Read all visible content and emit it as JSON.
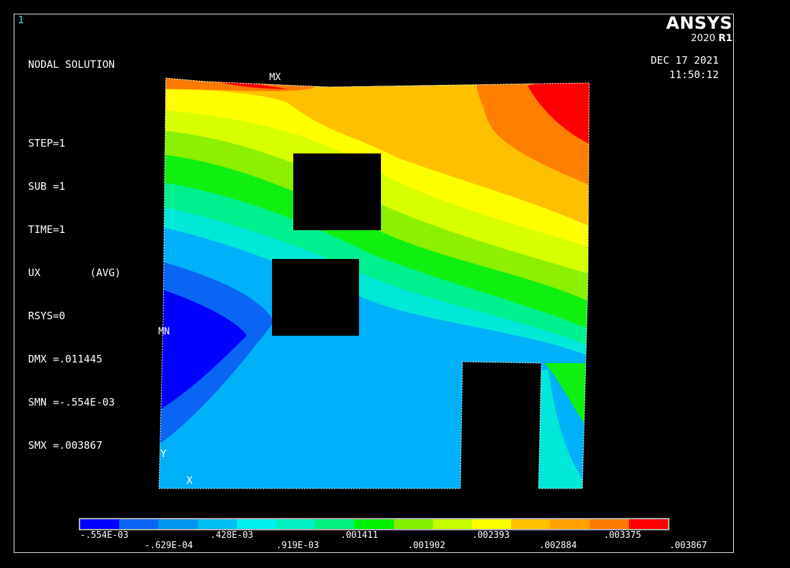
{
  "window_number": "1",
  "solution_info": {
    "title": "NODAL SOLUTION",
    "step": "STEP=1",
    "sub": "SUB =1",
    "time": "TIME=1",
    "component": "UX        (AVG)",
    "rsys": "RSYS=0",
    "dmx": "DMX =.011445",
    "smn": "SMN =-.554E-03",
    "smx": "SMX =.003867"
  },
  "logo": {
    "brand": "ANSYS",
    "version": "2020",
    "release": "R1"
  },
  "datetime": {
    "date": "DEC 17 2021",
    "time": "11:50:12"
  },
  "plot_markers": {
    "max": "MX",
    "min": "MN",
    "axis_y": "Y",
    "axis_x": "X"
  },
  "legend": {
    "colors": [
      "#0000ff",
      "#0a64f4",
      "#0096f0",
      "#00c0f0",
      "#00f0f0",
      "#00f0c0",
      "#00f080",
      "#00f000",
      "#80f000",
      "#c8ff00",
      "#ffff00",
      "#ffc000",
      "#ffa000",
      "#ff7a00",
      "#ff0000"
    ],
    "labels_top": [
      "-.554E-03",
      ".428E-03",
      ".001411",
      ".002393",
      ".003375"
    ],
    "labels_bottom": [
      "-.629E-04",
      ".919E-03",
      ".001902",
      ".002884",
      ".003867"
    ]
  }
}
